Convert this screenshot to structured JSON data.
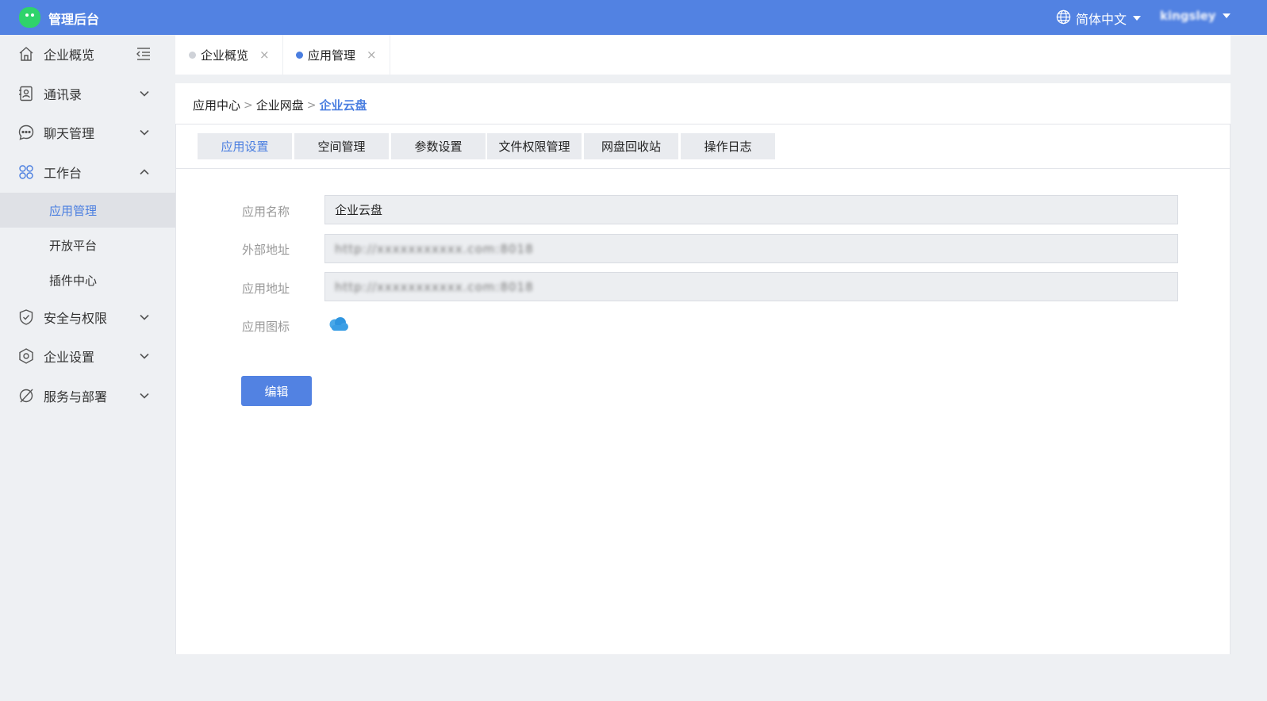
{
  "header": {
    "app_title": "管理后台",
    "language": "简体中文",
    "username": "kingsley"
  },
  "sidebar": {
    "items": [
      {
        "label": "企业概览",
        "icon": "home-icon"
      },
      {
        "label": "通讯录",
        "icon": "contacts-icon"
      },
      {
        "label": "聊天管理",
        "icon": "chat-icon"
      },
      {
        "label": "工作台",
        "icon": "workbench-icon"
      },
      {
        "label": "安全与权限",
        "icon": "shield-icon"
      },
      {
        "label": "企业设置",
        "icon": "settings-icon"
      },
      {
        "label": "服务与部署",
        "icon": "service-icon"
      }
    ],
    "sub_items": [
      {
        "label": "应用管理"
      },
      {
        "label": "开放平台"
      },
      {
        "label": "插件中心"
      }
    ]
  },
  "page_tabs": [
    {
      "label": "企业概览",
      "close": "×"
    },
    {
      "label": "应用管理",
      "close": "×"
    }
  ],
  "breadcrumb": {
    "items": [
      "应用中心",
      "企业网盘",
      "企业云盘"
    ],
    "separator": ">"
  },
  "sub_tabs": [
    {
      "label": "应用设置"
    },
    {
      "label": "空间管理"
    },
    {
      "label": "参数设置"
    },
    {
      "label": "文件权限管理"
    },
    {
      "label": "网盘回收站"
    },
    {
      "label": "操作日志"
    }
  ],
  "form": {
    "name_label": "应用名称",
    "name_value": "企业云盘",
    "external_label": "外部地址",
    "external_value": "http://xxxxxxxxxxx.com:8018",
    "app_url_label": "应用地址",
    "app_url_value": "http://xxxxxxxxxxx.com:8018",
    "icon_label": "应用图标",
    "icon_name": "cloud-icon"
  },
  "actions": {
    "edit_label": "编辑"
  },
  "colors": {
    "primary": "#5282e2",
    "accent_text": "#4a7ee0",
    "logo_green": "#2fd36b"
  }
}
